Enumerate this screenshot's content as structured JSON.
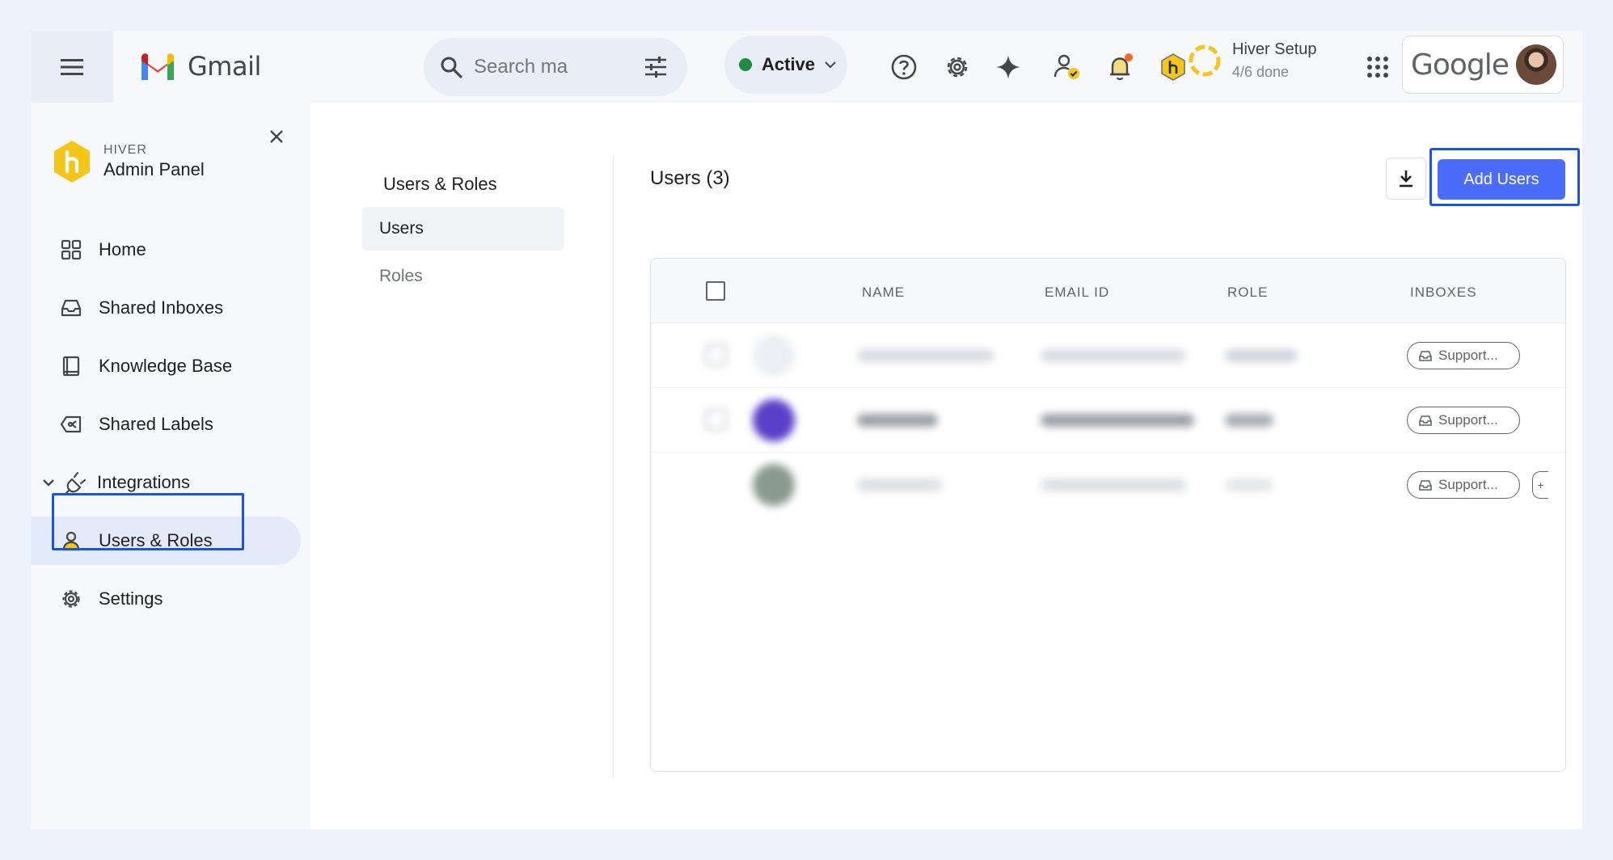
{
  "gmail": {
    "app_name": "Gmail",
    "search_placeholder": "Search ma",
    "status": "Active"
  },
  "setup": {
    "title": "Hiver Setup",
    "progress_text": "4/6 done"
  },
  "google_label": "Google",
  "brand": {
    "small": "HIVER",
    "title": "Admin Panel",
    "accent": "#f5c518"
  },
  "sidebar": {
    "items": [
      {
        "label": "Home",
        "icon": "grid-icon"
      },
      {
        "label": "Shared Inboxes",
        "icon": "inbox-icon"
      },
      {
        "label": "Knowledge Base",
        "icon": "book-icon"
      },
      {
        "label": "Shared Labels",
        "icon": "label-icon"
      },
      {
        "label": "Integrations",
        "icon": "plug-icon"
      },
      {
        "label": "Users & Roles",
        "icon": "user-icon"
      },
      {
        "label": "Settings",
        "icon": "gear-icon"
      }
    ],
    "active": "Users & Roles"
  },
  "subnav": {
    "title": "Users & Roles",
    "items": [
      "Users",
      "Roles"
    ],
    "active": "Users"
  },
  "users": {
    "title": "Users (3)",
    "add_button": "Add Users",
    "columns": [
      "NAME",
      "EMAIL ID",
      "ROLE",
      "INBOXES"
    ],
    "rows": [
      {
        "inbox": "Support..."
      },
      {
        "inbox": "Support..."
      },
      {
        "inbox": "Support..."
      }
    ]
  },
  "colors": {
    "primary": "#4b6bfb",
    "highlight": "#1a56db",
    "status_green": "#1e8e3e"
  }
}
